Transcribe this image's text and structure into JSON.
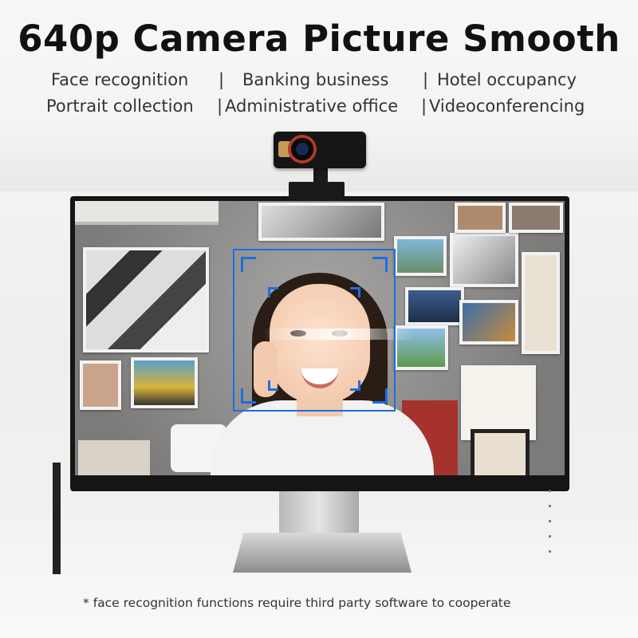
{
  "title": "640p Camera Picture Smooth",
  "use_cases": {
    "row1": [
      "Face recognition",
      "Banking business",
      "Hotel occupancy"
    ],
    "row2": [
      "Portrait collection",
      "Administrative office",
      "Videoconferencing"
    ],
    "separator": "|"
  },
  "footnote": "face recognition functions require third party software to cooperate",
  "footnote_marker": "*",
  "colors": {
    "detection_box": "#1b6fe0",
    "title": "#111111"
  }
}
